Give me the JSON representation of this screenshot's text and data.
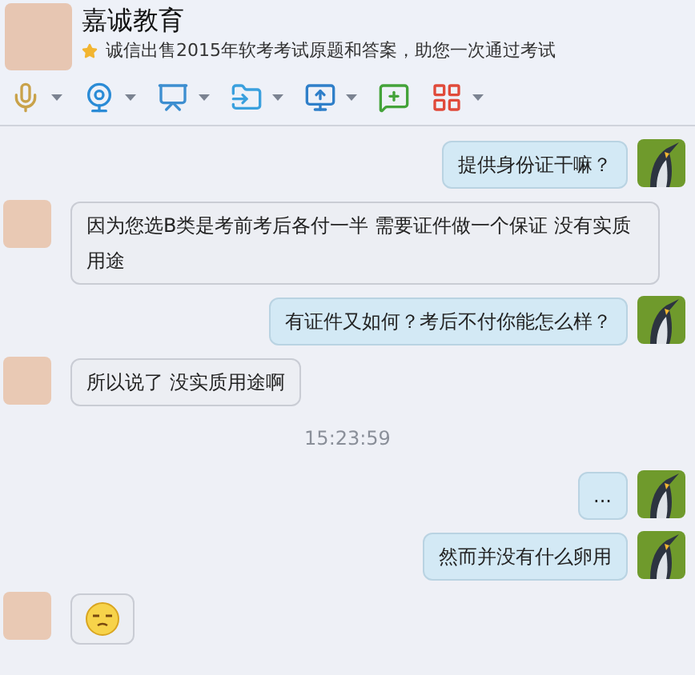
{
  "contact": {
    "name": "嘉诚教育",
    "signature": "诚信出售2015年软考考试原题和答案，助您一次通过考试"
  },
  "toolbar": [
    {
      "kind": "mic",
      "dropdown": true
    },
    {
      "kind": "webcam",
      "dropdown": true
    },
    {
      "kind": "screen",
      "dropdown": true
    },
    {
      "kind": "file",
      "dropdown": true
    },
    {
      "kind": "remote",
      "dropdown": true
    },
    {
      "kind": "chat",
      "dropdown": false
    },
    {
      "kind": "apps",
      "dropdown": true
    }
  ],
  "messages": [
    {
      "kind": "outgoing",
      "text": "提供身份证干嘛？"
    },
    {
      "kind": "incoming",
      "text": "因为您选B类是考前考后各付一半 需要证件做一个保证  没有实质用途"
    },
    {
      "kind": "outgoing",
      "text": "有证件又如何？考后不付你能怎么样？"
    },
    {
      "kind": "incoming",
      "text": "所以说了  没实质用途啊"
    },
    {
      "kind": "time",
      "text": "15:23:59"
    },
    {
      "kind": "outgoing",
      "text": "..."
    },
    {
      "kind": "outgoing",
      "text": "然而并没有什么卵用"
    },
    {
      "kind": "emoji"
    }
  ]
}
